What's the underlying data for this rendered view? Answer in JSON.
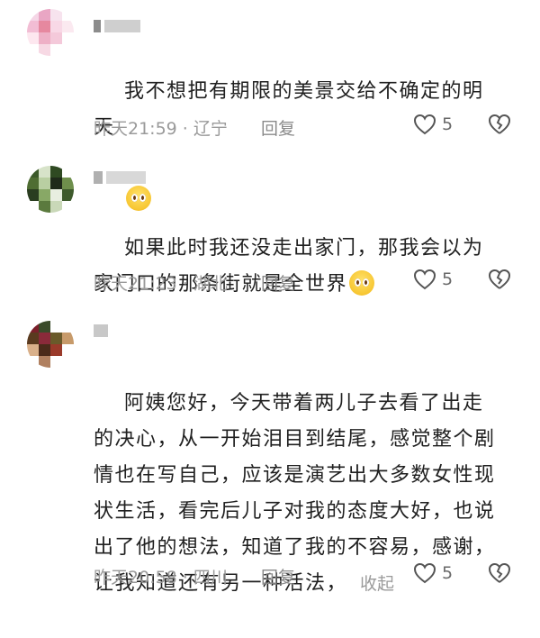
{
  "comments": [
    {
      "text": "我不想把有期限的美景交给不确定的明天",
      "emoji": "crying-face-emoji",
      "time": "昨天21:59",
      "location": "辽宁",
      "reply": "回复",
      "likes": "5"
    },
    {
      "text": "如果此时我还没走出家门，那我会以为家门口的那条街就是全世界",
      "emoji": "crying-face-emoji",
      "time": "昨天21:23",
      "location": "湖北",
      "reply": "回复",
      "likes": "5"
    },
    {
      "text": "阿姨您好，今天带着两儿子去看了出走的决心，从一开始泪目到结尾，感觉整个剧情也在写自己，应该是演艺出大多数女性现状生活，看完后儿子对我的态度大好，也说出了他的想法，知道了我的不容易，感谢，让我知道还有另一种活法，",
      "collapse": "收起",
      "time": "昨天20:58",
      "location": "四川",
      "reply": "回复",
      "likes": "5"
    }
  ],
  "separator": " · "
}
